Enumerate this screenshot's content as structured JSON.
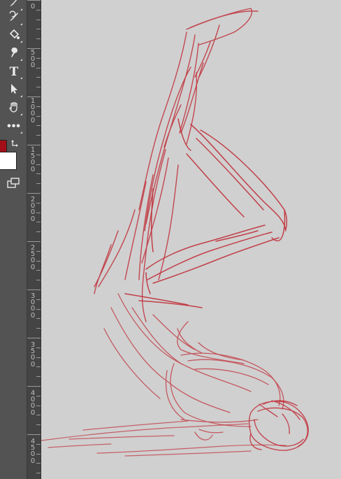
{
  "toolbar": {
    "tools": [
      {
        "icon": "brush-icon"
      },
      {
        "icon": "history-brush-icon"
      },
      {
        "icon": "paint-bucket-icon"
      },
      {
        "icon": "smudge-icon"
      },
      {
        "icon": "text-icon",
        "glyph": "T"
      },
      {
        "icon": "path-selection-icon"
      },
      {
        "icon": "hand-tool-icon"
      },
      {
        "icon": "more-tools-icon",
        "glyph": "•••"
      }
    ],
    "foreground_color": "#a30f18",
    "background_color": "#ffffff"
  },
  "ruler": {
    "labels": [
      "0",
      "500",
      "1000",
      "1500",
      "2000",
      "2500",
      "3000",
      "3500",
      "4000",
      "4500"
    ]
  },
  "canvas": {
    "background": "#d0d0d0",
    "stroke_color": "#c0303a"
  }
}
